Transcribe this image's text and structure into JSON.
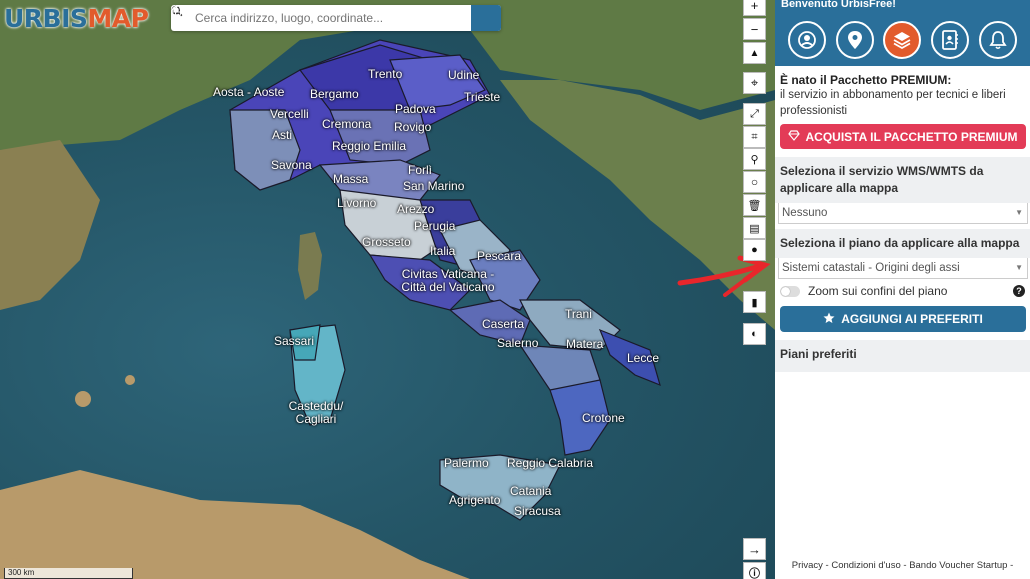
{
  "app": {
    "logo_part1": "URBIS",
    "logo_part2": "MAP"
  },
  "search": {
    "placeholder": "Cerca indirizzo, luogo, coordinate..."
  },
  "map": {
    "scale_label": "300 km",
    "cities": [
      "Aosta - Aoste",
      "Trento",
      "Udine",
      "Bergamo",
      "Vercelli",
      "Padova",
      "Trieste",
      "Cremona",
      "Rovigo",
      "Asti",
      "Reggio Emilia",
      "Savona",
      "Forlì",
      "Massa",
      "San Marino",
      "Livorno",
      "Arezzo",
      "Perugia",
      "Grosseto",
      "Italia",
      "Pescara",
      "Civitas Vaticana - Città del Vaticano",
      "Sassari",
      "Trani",
      "Caserta",
      "Salerno",
      "Matera",
      "Lecce",
      "Casteddu/ Cagliari",
      "Crotone",
      "Palermo",
      "Reggio Calabria",
      "Catania",
      "Agrigento",
      "Siracusa"
    ]
  },
  "panel": {
    "welcome": "Benvenuto UrbisFree!",
    "premium_title": "È nato il Pacchetto PREMIUM:",
    "premium_desc": "il servizio in abbonamento per tecnici e liberi professionisti",
    "premium_button": "ACQUISTA IL PACCHETTO PREMIUM",
    "wms_label": "Seleziona il servizio WMS/WMTS da applicare alla mappa",
    "wms_value": "Nessuno",
    "plan_label": "Seleziona il piano da applicare alla mappa",
    "plan_value": "Sistemi catastali - Origini degli assi",
    "zoom_label": "Zoom sui confini del piano",
    "fav_button": "AGGIUNGI AI PREFERITI",
    "fav_title": "Piani preferiti",
    "footer": "Privacy - Condizioni d'uso - Bando Voucher Startup - "
  },
  "colors": {
    "brand_blue": "#2a6f9a",
    "brand_orange": "#e25b2c",
    "premium_red": "#e33b57",
    "annotation_red": "#e8262b"
  }
}
